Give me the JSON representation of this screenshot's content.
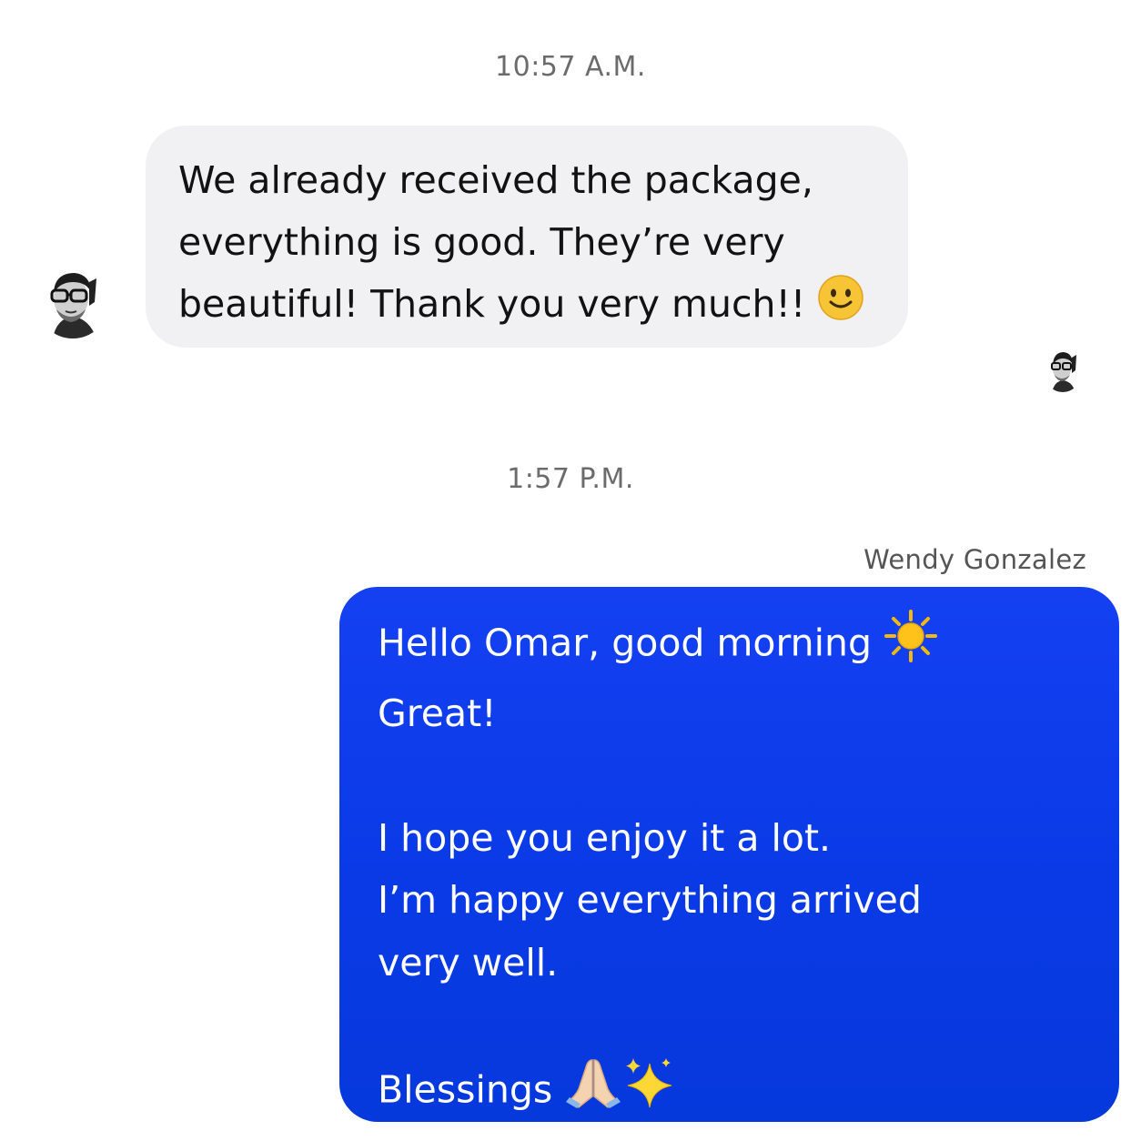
{
  "conversation": {
    "timestamps": [
      "10:57 A.M.",
      "1:57 P.M."
    ],
    "incoming_message": {
      "lines": [
        "We already received the package,",
        "everything is good. They’re very",
        "beautiful! Thank you very much!!"
      ],
      "emoji": "slightly-smiling-face"
    },
    "outgoing_message": {
      "sender_name": "Wendy Gonzalez",
      "lines": [
        "Hello Omar, good morning",
        "Great!",
        "",
        "I hope you enjoy it a lot.",
        "I’m happy everything arrived",
        "very well.",
        "",
        "Blessings"
      ],
      "emojis": [
        "sun",
        "folded-hands",
        "sparkles"
      ]
    },
    "avatars": [
      "contact-avatar",
      "read-receipt-avatar"
    ]
  },
  "colors": {
    "outgoing_bubble": "#0a3ae6",
    "incoming_bubble": "#f1f1f3",
    "timestamp_text": "#6b6b6b"
  }
}
